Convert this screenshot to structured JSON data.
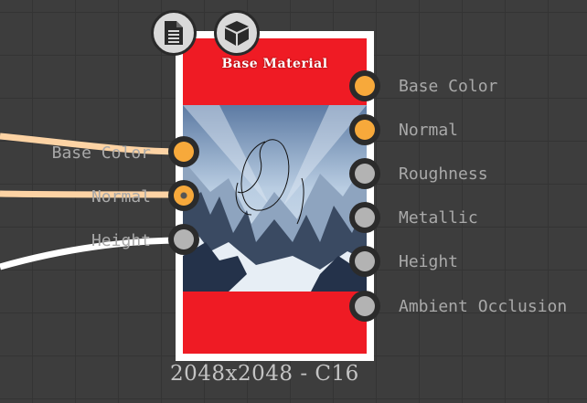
{
  "node": {
    "title": "Base Material",
    "resolution": "2048x2048 - C16",
    "accent_color": "#ef1b24",
    "header_icons": [
      "document-icon",
      "cube-icon"
    ]
  },
  "inputs": [
    {
      "label": "Base Color",
      "state": "active"
    },
    {
      "label": "Normal",
      "state": "linked"
    },
    {
      "label": "Height",
      "state": "idle"
    }
  ],
  "outputs": [
    {
      "label": "Base Color",
      "state": "active"
    },
    {
      "label": "Normal",
      "state": "active"
    },
    {
      "label": "Roughness",
      "state": "idle"
    },
    {
      "label": "Metallic",
      "state": "idle"
    },
    {
      "label": "Height",
      "state": "idle"
    },
    {
      "label": "Ambient Occlusion",
      "state": "idle"
    }
  ],
  "colors": {
    "connection_orange": "#fdd3a4",
    "connection_white": "#ffffff",
    "port_active": "#f7a93b",
    "port_idle": "#b3b3b3"
  }
}
